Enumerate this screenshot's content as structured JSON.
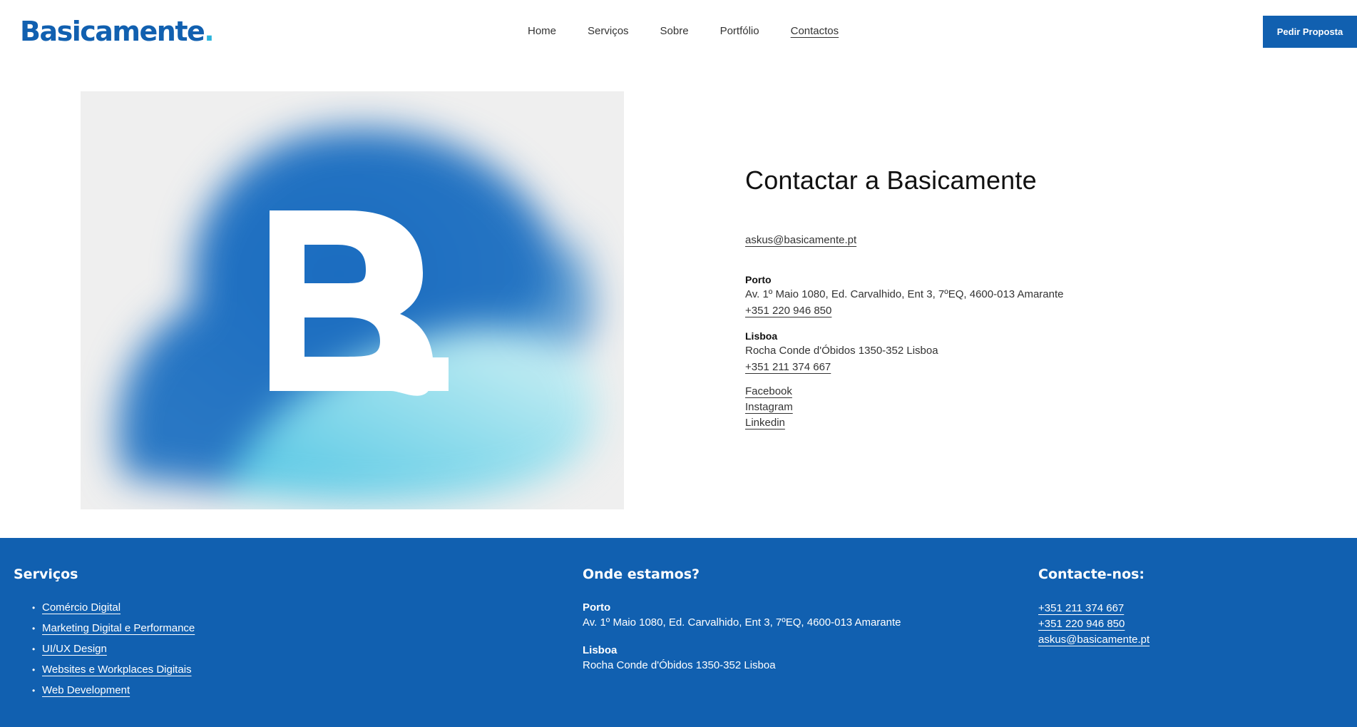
{
  "header": {
    "logo_text": "Basicamente",
    "logo_dot": ".",
    "nav": [
      {
        "label": "Home",
        "active": false
      },
      {
        "label": "Serviços",
        "active": false
      },
      {
        "label": "Sobre",
        "active": false
      },
      {
        "label": "Portfólio",
        "active": false
      },
      {
        "label": "Contactos",
        "active": true
      }
    ],
    "cta_label": "Pedir Proposta"
  },
  "hero": {
    "art_letter": "B."
  },
  "contact": {
    "title": "Contactar a Basicamente",
    "email": "askus@basicamente.pt",
    "offices": [
      {
        "name": "Porto",
        "address": "Av. 1º Maio 1080, Ed. Carvalhido, Ent 3, 7ºEQ, 4600-013 Amarante",
        "phone": "+351 220 946 850"
      },
      {
        "name": "Lisboa",
        "address": "Rocha Conde d'Óbidos 1350-352 Lisboa",
        "phone": "+351 211 374 667"
      }
    ],
    "socials": [
      "Facebook",
      "Instagram",
      "Linkedin"
    ]
  },
  "footer": {
    "services_title": "Serviços",
    "services": [
      "Comércio Digital",
      "Marketing Digital e Performance",
      "UI/UX Design",
      "Websites e Workplaces Digitais",
      "Web Development"
    ],
    "where_title": "Onde estamos?",
    "offices": [
      {
        "name": "Porto",
        "address": "Av. 1º Maio 1080, Ed. Carvalhido, Ent 3, 7ºEQ, 4600-013 Amarante"
      },
      {
        "name": "Lisboa",
        "address": "Rocha Conde d'Óbidos 1350-352 Lisboa"
      }
    ],
    "contact_title": "Contacte-nos:",
    "contacts": [
      "+351 211 374 667",
      "+351 220 946 850",
      "askus@basicamente.pt"
    ]
  },
  "colors": {
    "brand_blue": "#1160b0",
    "accent_cyan": "#2bb4dc",
    "footer_bg": "#1160b0"
  }
}
